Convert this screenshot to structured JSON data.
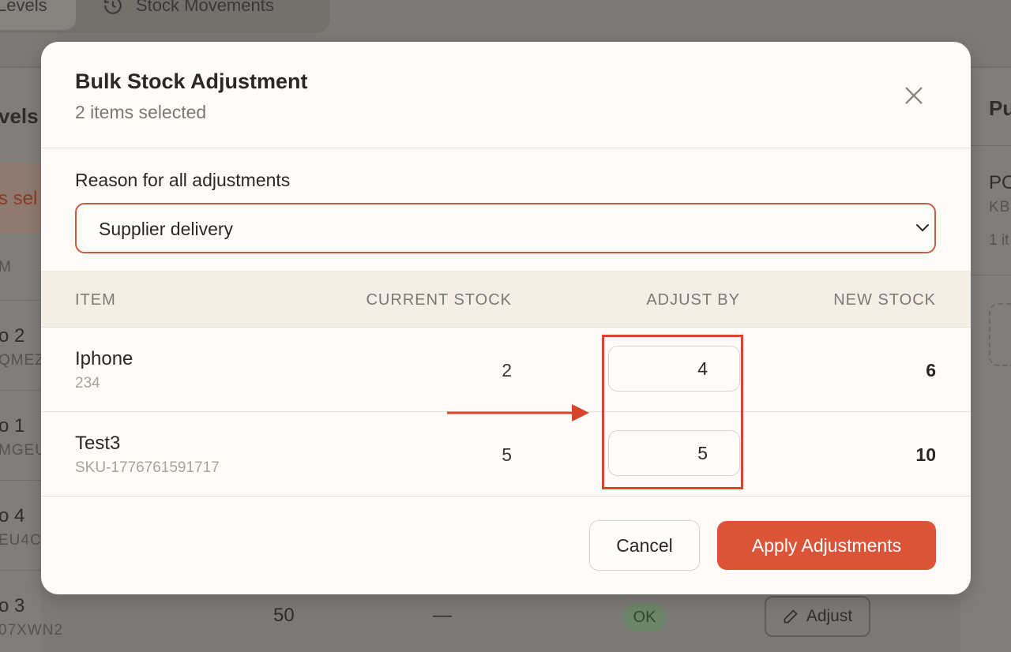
{
  "background": {
    "tabs": [
      {
        "label": "Levels"
      },
      {
        "label": "Stock Movements"
      }
    ],
    "left_panel": {
      "heading": "vels",
      "selection_banner": "s sel",
      "column_header": "M",
      "rows": [
        {
          "name": "o 2",
          "code": "QMEZ"
        },
        {
          "name": "o 1",
          "code": "MGEU"
        },
        {
          "name": "o 4",
          "code": "EU4C"
        },
        {
          "name": "o 3",
          "code": "07XWN2"
        }
      ]
    },
    "right_panel": {
      "heading": "Pu",
      "po": "PO",
      "po_code": "KB",
      "po_items": "1 it"
    },
    "bottom_row": {
      "qty": "50",
      "dash": "—",
      "status": "OK",
      "adjust_label": "Adjust"
    }
  },
  "modal": {
    "title": "Bulk Stock Adjustment",
    "subtitle": "2 items selected",
    "reason_label": "Reason for all adjustments",
    "reason_value": "Supplier delivery",
    "table": {
      "headers": {
        "item": "ITEM",
        "current": "CURRENT STOCK",
        "adjust": "ADJUST BY",
        "new": "NEW STOCK"
      },
      "rows": [
        {
          "name": "Iphone",
          "sku": "234",
          "current": "2",
          "adjust": "4",
          "new": "6"
        },
        {
          "name": "Test3",
          "sku": "SKU-1776761591717",
          "current": "5",
          "adjust": "5",
          "new": "10"
        }
      ]
    },
    "cancel_label": "Cancel",
    "apply_label": "Apply Adjustments"
  },
  "colors": {
    "accent": "#dc5438",
    "annotation": "#d9442c",
    "modal_bg": "#fdfcf8",
    "header_bg": "#f3efe7"
  }
}
